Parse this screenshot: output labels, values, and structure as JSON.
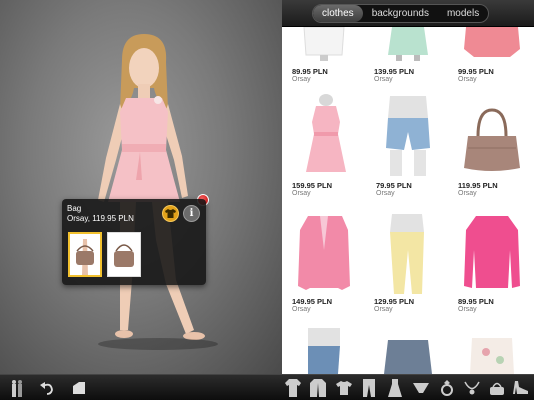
{
  "segments": [
    {
      "label": "clothes",
      "active": true
    },
    {
      "label": "backgrounds",
      "active": false
    },
    {
      "label": "models",
      "active": false
    }
  ],
  "popup": {
    "title": "Bag",
    "subtitle": "Orsay, 119.95 PLN",
    "info_label": "i"
  },
  "catalog": {
    "rows": [
      [
        {
          "price": "89.95 PLN",
          "brand": "Orsay",
          "item": "white-blouse"
        },
        {
          "price": "139.95 PLN",
          "brand": "Orsay",
          "item": "mint-dress"
        },
        {
          "price": "99.95 PLN",
          "brand": "Orsay",
          "item": "pink-top"
        }
      ],
      [
        {
          "price": "159.95 PLN",
          "brand": "Orsay",
          "item": "pink-dress"
        },
        {
          "price": "79.95 PLN",
          "brand": "Orsay",
          "item": "denim-shorts"
        },
        {
          "price": "119.95 PLN",
          "brand": "Orsay",
          "item": "brown-bag"
        }
      ],
      [
        {
          "price": "149.95 PLN",
          "brand": "Orsay",
          "item": "pink-blazer"
        },
        {
          "price": "129.95 PLN",
          "brand": "Orsay",
          "item": "yellow-trousers"
        },
        {
          "price": "89.95 PLN",
          "brand": "Orsay",
          "item": "pink-shirt"
        }
      ],
      [
        {
          "price": "",
          "brand": "",
          "item": "jeans"
        },
        {
          "price": "",
          "brand": "",
          "item": "grey-blouse"
        },
        {
          "price": "",
          "brand": "",
          "item": "floral-top"
        }
      ]
    ]
  },
  "toolbar": {
    "left_icons": [
      "models-icon",
      "undo-icon",
      "eraser-icon"
    ],
    "category_icons": [
      "outfit-icon",
      "jacket-icon",
      "tshirt-icon",
      "trousers-icon",
      "dress-icon",
      "underwear-icon",
      "ring-icon",
      "necklace-icon",
      "handbag-icon",
      "shoe-icon"
    ]
  },
  "colors": {
    "accent": "#e3a21a",
    "selected_border": "#f2c12e",
    "pin": "#c40000"
  }
}
